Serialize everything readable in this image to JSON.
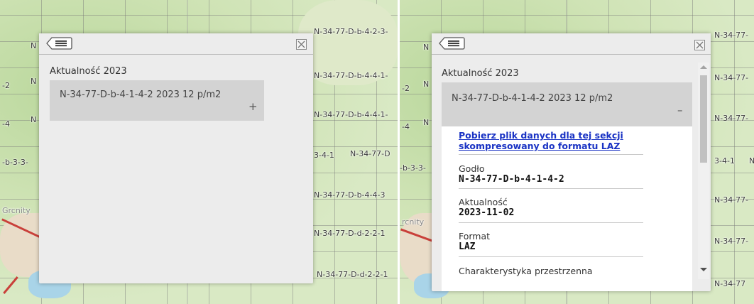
{
  "left": {
    "map_labels": [
      "N-34-77-D-b-4-2-3-",
      "N-34-77-D-b-4-4-1-",
      "N-34-77-D-b-4-4-1-",
      "N-34-77-D",
      "N-34-77-D-b-4-4-3",
      "N-34-77-D-d-2-2-1",
      "N-34-77-D-d-2-2-1",
      "N",
      "-2",
      "N",
      "-4",
      "N",
      "-b-3-3-",
      "3-4-1",
      "Grcnity"
    ],
    "panel": {
      "section_title": "Aktualność 2023",
      "item_title": "N-34-77-D-b-4-1-4-2 2023 12 p/m2",
      "toggle_symbol": "+",
      "close_symbol": "☒"
    }
  },
  "right": {
    "map_labels": [
      "N-34-77-",
      "N-34-77-",
      "N-34-77-",
      "3-4-1",
      "N-34-77-",
      "N-34-77-",
      "N-34-77",
      "N",
      "-2",
      "N",
      "-4",
      "N",
      "-b-3-3-",
      "N",
      "rcnity"
    ],
    "panel": {
      "section_title": "Aktualność 2023",
      "item_title": "N-34-77-D-b-4-1-4-2 2023 12 p/m2",
      "toggle_symbol": "–",
      "download_link": "Pobierz plik danych dla tej sekcji skompresowany do formatu LAZ",
      "fields": [
        {
          "label": "Godło",
          "value": "N-34-77-D-b-4-1-4-2"
        },
        {
          "label": "Aktualność",
          "value": "2023-11-02"
        },
        {
          "label": "Format",
          "value": "LAZ"
        },
        {
          "label": "Charakterystyka przestrzenna",
          "value": ""
        }
      ]
    }
  },
  "colors": {
    "panel_bg": "#ececec",
    "accordion_bg": "#d3d3d3",
    "link": "#1a33c4",
    "map_green": "#cfe2b6"
  },
  "icons": {
    "back": "list-back-icon",
    "close": "close-icon",
    "scroll_up": "scroll-up-arrow-icon",
    "scroll_down": "scroll-down-arrow-icon"
  }
}
